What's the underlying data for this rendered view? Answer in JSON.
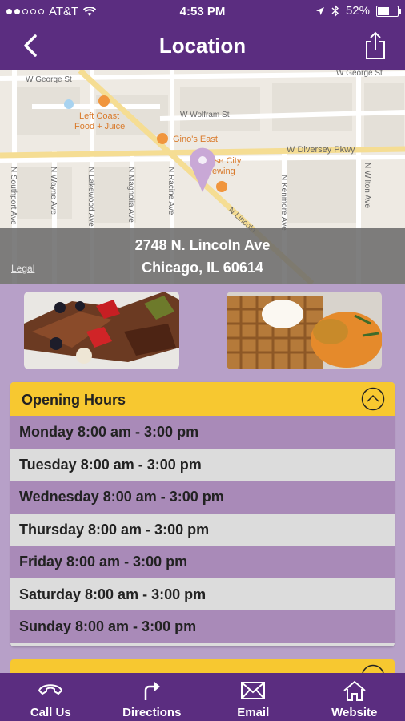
{
  "status_bar": {
    "carrier": "AT&T",
    "time": "4:53 PM",
    "battery": "52%",
    "battery_level": 0.52
  },
  "nav": {
    "title": "Location",
    "back_icon": "chevron-left-icon",
    "share_icon": "share-icon"
  },
  "map": {
    "streets": {
      "w_george": "W George St",
      "w_wolfram": "W Wolfram St",
      "w_diversey": "W Diversey Pkwy",
      "n_lincoln": "N Lincoln",
      "n_southport": "N Southport Ave",
      "n_wayne": "N Wayne Ave",
      "n_lakewood": "N Lakewood Ave",
      "n_magnolia": "N Magnolia Ave",
      "n_racine": "N Racine Ave",
      "n_kenmore": "N Kenmore Ave",
      "n_wilton": "N Wilton Ave"
    },
    "pois": {
      "left_coast_1": "Left Coast",
      "left_coast_2": "Food + Juice",
      "ginos": "Gino's East",
      "goose_1": "Goose City",
      "goose_2": "Brewing"
    },
    "legal": "Legal"
  },
  "address": {
    "line1": "2748 N. Lincoln Ave",
    "line2": "Chicago, IL 60614"
  },
  "hours": {
    "title": "Opening Hours",
    "toggle_icon": "chevron-up-circle-icon",
    "rows": [
      "Monday 8:00 am - 3:00 pm",
      "Tuesday 8:00 am - 3:00 pm",
      "Wednesday 8:00 am - 3:00 pm",
      "Thursday 8:00 am - 3:00 pm",
      "Friday 8:00 am - 3:00 pm",
      "Saturday 8:00 am - 3:00 pm",
      "Sunday 8:00 am - 3:00 pm"
    ]
  },
  "tabs": [
    {
      "label": "Call Us",
      "icon": "phone-icon"
    },
    {
      "label": "Directions",
      "icon": "directions-arrow-icon"
    },
    {
      "label": "Email",
      "icon": "envelope-icon"
    },
    {
      "label": "Website",
      "icon": "home-icon"
    }
  ],
  "colors": {
    "brand_purple": "#5b2d80",
    "accent_yellow": "#f7c830",
    "row_purple": "#a98ab8",
    "background": "#b7a0c8"
  }
}
